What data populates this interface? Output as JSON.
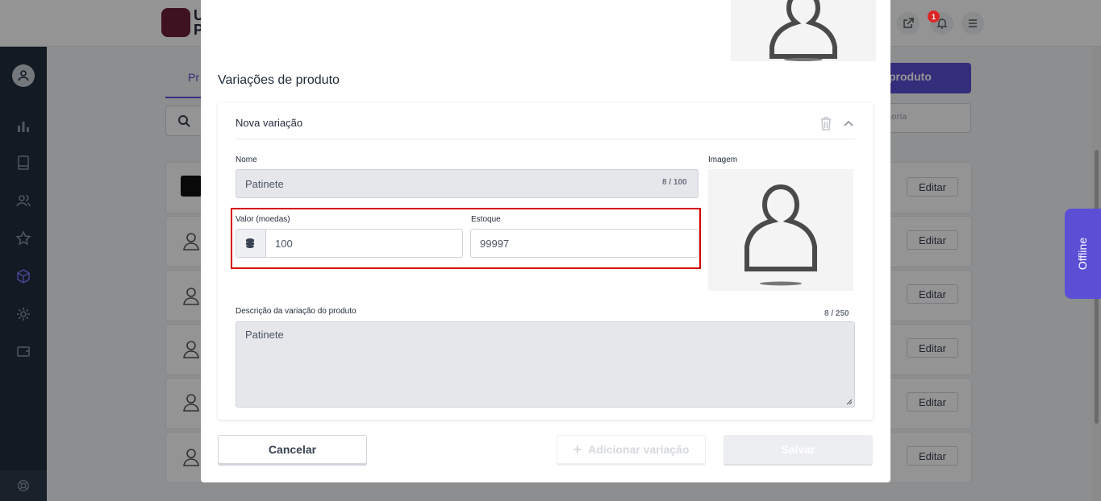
{
  "background": {
    "logo_text": "U\nP",
    "tab_label": "Pr",
    "new_button_label": "produto",
    "category_placeholder": "goria",
    "edit_label": "Editar",
    "notification_count": "1"
  },
  "offline_label": "Offline",
  "modal": {
    "section_title": "Variações de produto",
    "variation": {
      "header": "Nova variação",
      "name_label": "Nome",
      "name_value": "Patinete",
      "name_counter": "8 / 100",
      "value_label": "Valor (moedas)",
      "value_value": "100",
      "stock_label": "Estoque",
      "stock_value": "99997",
      "image_label": "Imagem",
      "description_label": "Descrição da variação do produto",
      "description_counter": "8 / 250",
      "description_value": "Patinete"
    },
    "cancel_label": "Cancelar",
    "add_variation_label": "Adicionar variação",
    "save_label": "Salvar"
  },
  "colors": {
    "accent": "#5b4fd6",
    "highlight": "#d40000",
    "sidebar": "#1f2d3d"
  },
  "icons": [
    "user-icon",
    "bar-chart-icon",
    "book-icon",
    "users-icon",
    "star-icon",
    "cube-icon",
    "gear-icon",
    "wallet-icon",
    "lifebuoy-icon",
    "external-link-icon",
    "bell-icon",
    "menu-icon",
    "search-icon",
    "trash-icon",
    "chevron-up-icon",
    "coins-icon",
    "plus-icon",
    "person-placeholder-icon"
  ]
}
